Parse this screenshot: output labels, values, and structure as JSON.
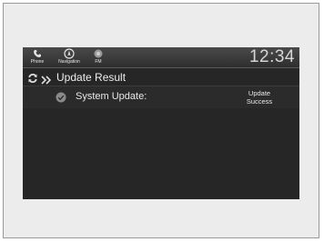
{
  "statusbar": {
    "buttons": [
      {
        "label": "Phone",
        "icon": "phone-icon"
      },
      {
        "label": "Navigation",
        "icon": "navigation-icon"
      },
      {
        "label": "FM",
        "icon": "radio-icon"
      }
    ],
    "clock": "12:34"
  },
  "header": {
    "title": "Update Result",
    "icons": [
      "refresh-icon",
      "chevrons-icon"
    ]
  },
  "list": {
    "items": [
      {
        "label": "System Update:",
        "status_line1": "Update",
        "status_line2": "Success",
        "icon": "check-circle-icon"
      }
    ]
  },
  "colors": {
    "screen_background": "#262626",
    "text": "#e8e8e8",
    "frame": "#ececec"
  }
}
